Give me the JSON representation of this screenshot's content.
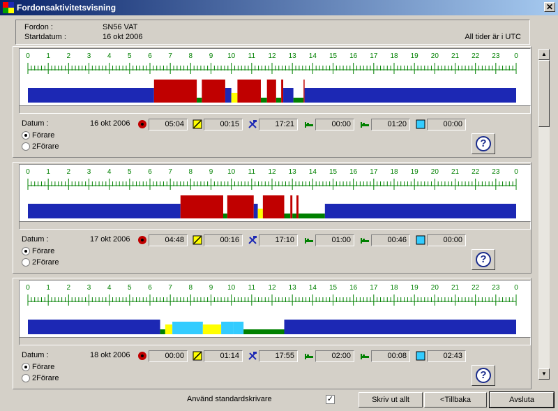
{
  "window": {
    "title": "Fordonsaktivitetsvisning",
    "close_glyph": "✕"
  },
  "header": {
    "vehicle_label": "Fordon :",
    "vehicle_value": "SN56 VAT",
    "start_label": "Startdatum :",
    "start_value": "16 okt 2006",
    "utc_note": "All tider är i UTC"
  },
  "colors": {
    "driving": "#c00000",
    "rest": "#1c28b4",
    "work": "#008000",
    "available": "#ffff00",
    "unknown": "#33ccff",
    "tick": "#008000",
    "hour_label": "#008000"
  },
  "hours": [
    "0",
    "1",
    "2",
    "3",
    "4",
    "5",
    "6",
    "7",
    "8",
    "9",
    "10",
    "11",
    "12",
    "13",
    "14",
    "15",
    "16",
    "17",
    "18",
    "19",
    "20",
    "21",
    "22",
    "23",
    "0"
  ],
  "days": [
    {
      "date_label": "Datum :",
      "date": "16 okt 2006",
      "times": {
        "driving": "05:04",
        "available": "00:15",
        "work": "17:21",
        "rest1": "00:00",
        "rest2": "01:20",
        "unknown": "00:00"
      },
      "radio_driver": "Förare",
      "radio_codriver": "2Förare",
      "selected": "driver",
      "activities": [
        {
          "type": "rest",
          "start": 0.0,
          "end": 6.2
        },
        {
          "type": "driving",
          "start": 6.2,
          "end": 8.3
        },
        {
          "type": "work",
          "start": 8.3,
          "end": 8.55
        },
        {
          "type": "driving",
          "start": 8.55,
          "end": 9.7
        },
        {
          "type": "rest",
          "start": 9.7,
          "end": 10.0
        },
        {
          "type": "available",
          "start": 10.0,
          "end": 10.3
        },
        {
          "type": "driving",
          "start": 10.3,
          "end": 11.45
        },
        {
          "type": "work",
          "start": 11.45,
          "end": 11.75
        },
        {
          "type": "driving",
          "start": 11.75,
          "end": 12.2
        },
        {
          "type": "work",
          "start": 12.2,
          "end": 12.45
        },
        {
          "type": "driving",
          "start": 12.45,
          "end": 12.55
        },
        {
          "type": "rest",
          "start": 12.55,
          "end": 13.05
        },
        {
          "type": "work",
          "start": 13.05,
          "end": 13.55
        },
        {
          "type": "driving",
          "start": 13.55,
          "end": 13.6
        },
        {
          "type": "rest",
          "start": 13.6,
          "end": 24.0
        }
      ]
    },
    {
      "date_label": "Datum :",
      "date": "17 okt 2006",
      "times": {
        "driving": "04:48",
        "available": "00:16",
        "work": "17:10",
        "rest1": "01:00",
        "rest2": "00:46",
        "unknown": "00:00"
      },
      "radio_driver": "Förare",
      "radio_codriver": "2Förare",
      "selected": "driver",
      "activities": [
        {
          "type": "rest",
          "start": 0.0,
          "end": 7.5
        },
        {
          "type": "driving",
          "start": 7.5,
          "end": 9.6
        },
        {
          "type": "work",
          "start": 9.6,
          "end": 9.8
        },
        {
          "type": "driving",
          "start": 9.8,
          "end": 11.1
        },
        {
          "type": "rest",
          "start": 11.1,
          "end": 11.3
        },
        {
          "type": "available",
          "start": 11.3,
          "end": 11.55
        },
        {
          "type": "driving",
          "start": 11.55,
          "end": 12.6
        },
        {
          "type": "work",
          "start": 12.6,
          "end": 12.9
        },
        {
          "type": "driving",
          "start": 12.9,
          "end": 13.0
        },
        {
          "type": "work",
          "start": 13.0,
          "end": 13.2
        },
        {
          "type": "driving",
          "start": 13.2,
          "end": 13.3
        },
        {
          "type": "work",
          "start": 13.3,
          "end": 14.6
        },
        {
          "type": "rest",
          "start": 14.6,
          "end": 24.0
        }
      ]
    },
    {
      "date_label": "Datum :",
      "date": "18 okt 2006",
      "times": {
        "driving": "00:00",
        "available": "01:14",
        "work": "17:55",
        "rest1": "02:00",
        "rest2": "00:08",
        "unknown": "02:43"
      },
      "radio_driver": "Förare",
      "radio_codriver": "2Förare",
      "selected": "driver",
      "activities": [
        {
          "type": "rest",
          "start": 0.0,
          "end": 6.5
        },
        {
          "type": "work",
          "start": 6.5,
          "end": 6.75
        },
        {
          "type": "available",
          "start": 6.75,
          "end": 7.1
        },
        {
          "type": "unknown",
          "start": 7.1,
          "end": 8.6
        },
        {
          "type": "available",
          "start": 8.6,
          "end": 9.5
        },
        {
          "type": "unknown",
          "start": 9.5,
          "end": 10.1
        },
        {
          "type": "unknown",
          "start": 10.1,
          "end": 10.6
        },
        {
          "type": "work",
          "start": 10.6,
          "end": 12.6
        },
        {
          "type": "rest",
          "start": 12.6,
          "end": 24.0
        }
      ]
    }
  ],
  "footer": {
    "default_printer_label": "Använd standardskrivare",
    "default_printer_checked": true,
    "print_all_button": "Skriv ut allt",
    "back_button": "<Tillbaka",
    "exit_button": "Avsluta"
  },
  "scrollbar": {
    "up_glyph": "▲",
    "down_glyph": "▼"
  },
  "help_glyph": "?"
}
